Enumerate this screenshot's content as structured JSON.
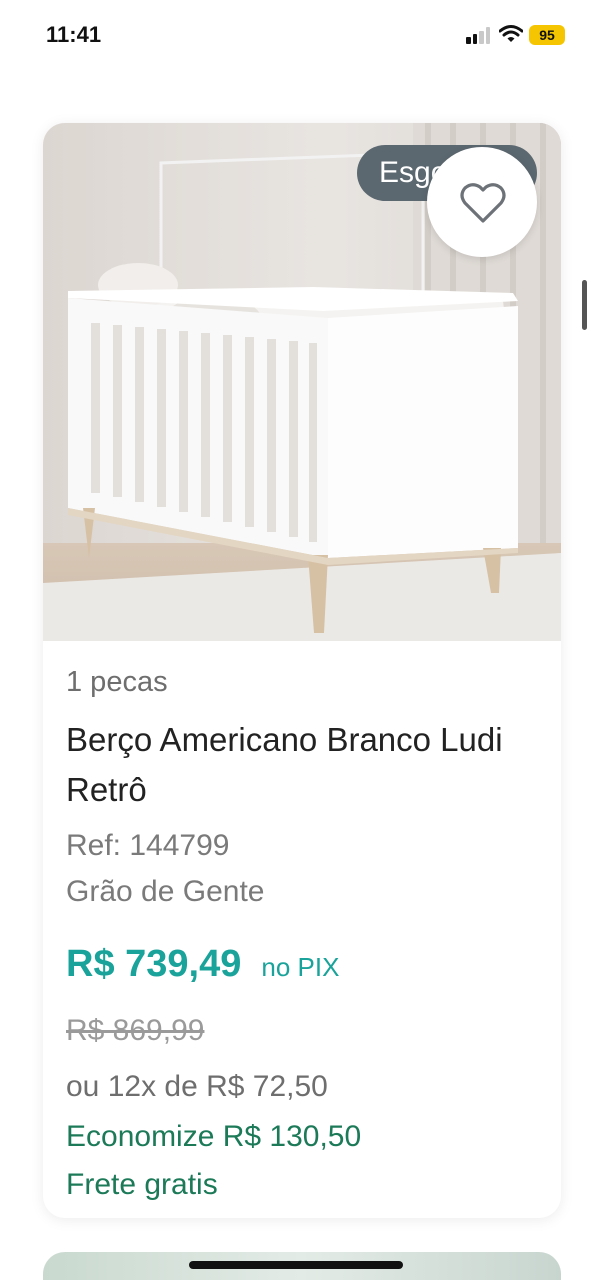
{
  "status_bar": {
    "time": "11:41",
    "battery": "95",
    "battery_color": "#f4c500"
  },
  "product": {
    "image_alt": "white crib product photo",
    "stock_badge": "Esgotado",
    "favorite_icon": "heart-outline-icon",
    "pieces": "1 pecas",
    "title": "Berço Americano Branco Ludi Retrô",
    "ref": "Ref: 144799",
    "brand": "Grão de Gente",
    "price_pix": "R$ 739,49",
    "pix_label": "no PIX",
    "old_price": "R$ 869,99",
    "installments": "ou 12x de R$ 72,50",
    "savings": "Economize R$ 130,50",
    "shipping": "Frete gratis"
  },
  "colors": {
    "accent": "#1aa39a",
    "savings": "#1c7a59",
    "badge_bg": "#5c6870"
  }
}
